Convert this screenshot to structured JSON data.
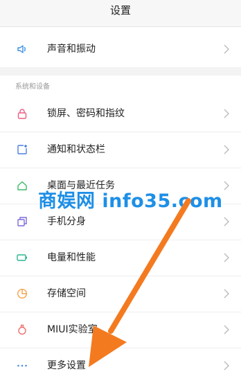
{
  "header": {
    "title": "设置"
  },
  "top_item": {
    "label": "声音和振动",
    "icon": "speaker-icon"
  },
  "section": {
    "label": "系统和设备"
  },
  "items": [
    {
      "label": "锁屏、密码和指纹",
      "icon": "lock-icon"
    },
    {
      "label": "通知和状态栏",
      "icon": "notification-icon"
    },
    {
      "label": "桌面与最近任务",
      "icon": "home-icon"
    },
    {
      "label": "手机分身",
      "icon": "copy-icon"
    },
    {
      "label": "电量和性能",
      "icon": "battery-icon"
    },
    {
      "label": "存储空间",
      "icon": "storage-pie-icon"
    },
    {
      "label": "MIUI实验室",
      "icon": "flask-icon"
    },
    {
      "label": "更多设置",
      "icon": "more-dots-icon"
    }
  ],
  "watermark": {
    "text": "商娱网 info35.com"
  },
  "colors": {
    "watermark": "#1e8fe6",
    "arrow": "#f47a20",
    "speaker": "#3a8fe0",
    "lock": "#ec5d84",
    "notification": "#4a7fe0",
    "home": "#3dbb6a",
    "copy": "#7b6bd8",
    "battery": "#2bb58f",
    "storage": "#f5a24a",
    "flask": "#ee6e6e",
    "more": "#4a8fe0"
  }
}
